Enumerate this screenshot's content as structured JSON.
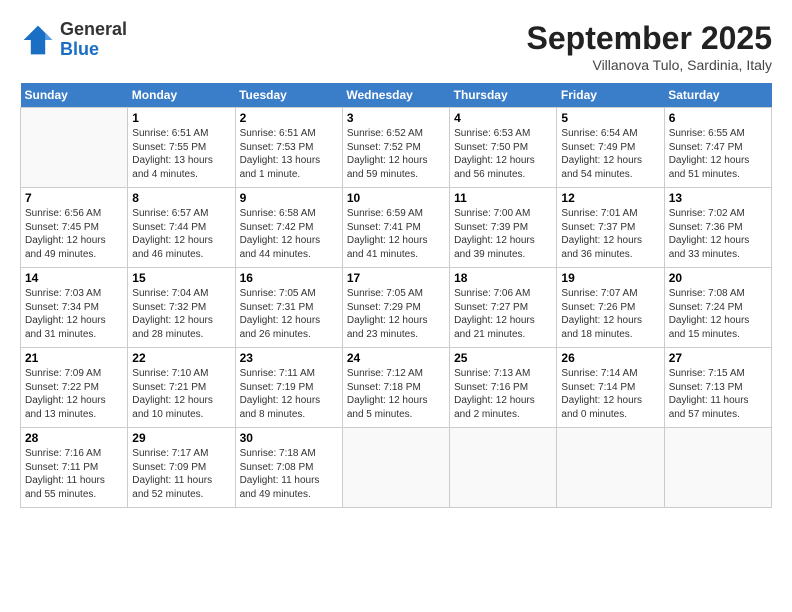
{
  "header": {
    "logo_general": "General",
    "logo_blue": "Blue",
    "month_title": "September 2025",
    "subtitle": "Villanova Tulo, Sardinia, Italy"
  },
  "weekdays": [
    "Sunday",
    "Monday",
    "Tuesday",
    "Wednesday",
    "Thursday",
    "Friday",
    "Saturday"
  ],
  "weeks": [
    [
      {
        "day": "",
        "info": ""
      },
      {
        "day": "1",
        "info": "Sunrise: 6:51 AM\nSunset: 7:55 PM\nDaylight: 13 hours\nand 4 minutes."
      },
      {
        "day": "2",
        "info": "Sunrise: 6:51 AM\nSunset: 7:53 PM\nDaylight: 13 hours\nand 1 minute."
      },
      {
        "day": "3",
        "info": "Sunrise: 6:52 AM\nSunset: 7:52 PM\nDaylight: 12 hours\nand 59 minutes."
      },
      {
        "day": "4",
        "info": "Sunrise: 6:53 AM\nSunset: 7:50 PM\nDaylight: 12 hours\nand 56 minutes."
      },
      {
        "day": "5",
        "info": "Sunrise: 6:54 AM\nSunset: 7:49 PM\nDaylight: 12 hours\nand 54 minutes."
      },
      {
        "day": "6",
        "info": "Sunrise: 6:55 AM\nSunset: 7:47 PM\nDaylight: 12 hours\nand 51 minutes."
      }
    ],
    [
      {
        "day": "7",
        "info": "Sunrise: 6:56 AM\nSunset: 7:45 PM\nDaylight: 12 hours\nand 49 minutes."
      },
      {
        "day": "8",
        "info": "Sunrise: 6:57 AM\nSunset: 7:44 PM\nDaylight: 12 hours\nand 46 minutes."
      },
      {
        "day": "9",
        "info": "Sunrise: 6:58 AM\nSunset: 7:42 PM\nDaylight: 12 hours\nand 44 minutes."
      },
      {
        "day": "10",
        "info": "Sunrise: 6:59 AM\nSunset: 7:41 PM\nDaylight: 12 hours\nand 41 minutes."
      },
      {
        "day": "11",
        "info": "Sunrise: 7:00 AM\nSunset: 7:39 PM\nDaylight: 12 hours\nand 39 minutes."
      },
      {
        "day": "12",
        "info": "Sunrise: 7:01 AM\nSunset: 7:37 PM\nDaylight: 12 hours\nand 36 minutes."
      },
      {
        "day": "13",
        "info": "Sunrise: 7:02 AM\nSunset: 7:36 PM\nDaylight: 12 hours\nand 33 minutes."
      }
    ],
    [
      {
        "day": "14",
        "info": "Sunrise: 7:03 AM\nSunset: 7:34 PM\nDaylight: 12 hours\nand 31 minutes."
      },
      {
        "day": "15",
        "info": "Sunrise: 7:04 AM\nSunset: 7:32 PM\nDaylight: 12 hours\nand 28 minutes."
      },
      {
        "day": "16",
        "info": "Sunrise: 7:05 AM\nSunset: 7:31 PM\nDaylight: 12 hours\nand 26 minutes."
      },
      {
        "day": "17",
        "info": "Sunrise: 7:05 AM\nSunset: 7:29 PM\nDaylight: 12 hours\nand 23 minutes."
      },
      {
        "day": "18",
        "info": "Sunrise: 7:06 AM\nSunset: 7:27 PM\nDaylight: 12 hours\nand 21 minutes."
      },
      {
        "day": "19",
        "info": "Sunrise: 7:07 AM\nSunset: 7:26 PM\nDaylight: 12 hours\nand 18 minutes."
      },
      {
        "day": "20",
        "info": "Sunrise: 7:08 AM\nSunset: 7:24 PM\nDaylight: 12 hours\nand 15 minutes."
      }
    ],
    [
      {
        "day": "21",
        "info": "Sunrise: 7:09 AM\nSunset: 7:22 PM\nDaylight: 12 hours\nand 13 minutes."
      },
      {
        "day": "22",
        "info": "Sunrise: 7:10 AM\nSunset: 7:21 PM\nDaylight: 12 hours\nand 10 minutes."
      },
      {
        "day": "23",
        "info": "Sunrise: 7:11 AM\nSunset: 7:19 PM\nDaylight: 12 hours\nand 8 minutes."
      },
      {
        "day": "24",
        "info": "Sunrise: 7:12 AM\nSunset: 7:18 PM\nDaylight: 12 hours\nand 5 minutes."
      },
      {
        "day": "25",
        "info": "Sunrise: 7:13 AM\nSunset: 7:16 PM\nDaylight: 12 hours\nand 2 minutes."
      },
      {
        "day": "26",
        "info": "Sunrise: 7:14 AM\nSunset: 7:14 PM\nDaylight: 12 hours\nand 0 minutes."
      },
      {
        "day": "27",
        "info": "Sunrise: 7:15 AM\nSunset: 7:13 PM\nDaylight: 11 hours\nand 57 minutes."
      }
    ],
    [
      {
        "day": "28",
        "info": "Sunrise: 7:16 AM\nSunset: 7:11 PM\nDaylight: 11 hours\nand 55 minutes."
      },
      {
        "day": "29",
        "info": "Sunrise: 7:17 AM\nSunset: 7:09 PM\nDaylight: 11 hours\nand 52 minutes."
      },
      {
        "day": "30",
        "info": "Sunrise: 7:18 AM\nSunset: 7:08 PM\nDaylight: 11 hours\nand 49 minutes."
      },
      {
        "day": "",
        "info": ""
      },
      {
        "day": "",
        "info": ""
      },
      {
        "day": "",
        "info": ""
      },
      {
        "day": "",
        "info": ""
      }
    ]
  ]
}
